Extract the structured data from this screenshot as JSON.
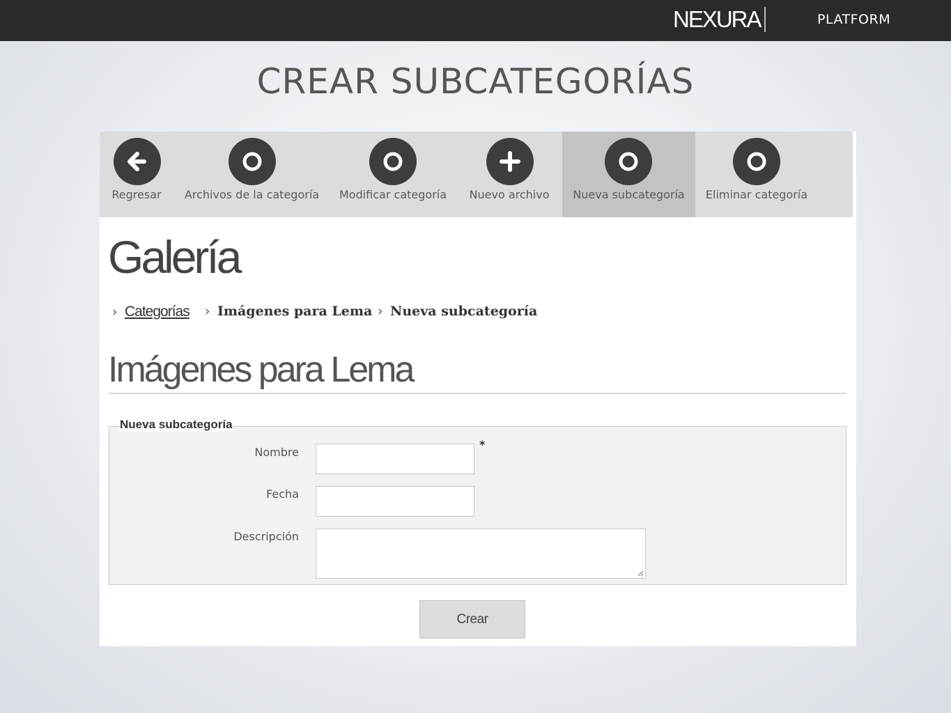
{
  "header": {
    "logo_text": "NEXURA",
    "product": "PLATFORM"
  },
  "slide": {
    "title": "CREAR SUBCATEGORÍAS"
  },
  "toolbar": {
    "items": [
      {
        "label": "Regresar",
        "icon": "arrow-left-icon"
      },
      {
        "label": "Archivos de la categoría",
        "icon": "circle-icon"
      },
      {
        "label": "Modificar categoría",
        "icon": "circle-icon"
      },
      {
        "label": "Nuevo archivo",
        "icon": "plus-icon"
      },
      {
        "label": "Nueva subcategoría",
        "icon": "circle-icon",
        "active": true
      },
      {
        "label": "Eliminar categoría",
        "icon": "circle-icon"
      }
    ]
  },
  "page": {
    "title": "Galería",
    "breadcrumb": [
      "Categorías",
      "Imágenes para Lema",
      "Nueva subcategoría"
    ],
    "section_title": "Imágenes para Lema"
  },
  "form": {
    "legend": "Nueva subcategoría",
    "fields": [
      {
        "label": "Nombre",
        "value": "",
        "required_mark": "*"
      },
      {
        "label": "Fecha",
        "value": ""
      },
      {
        "label": "Descripción",
        "value": ""
      }
    ],
    "submit_label": "Crear"
  },
  "colors": {
    "topbar": "#2a2a2a",
    "toolbar": "#dcdcdc",
    "toolbar_active": "#c3c3c3",
    "icon_circle": "#3d3d3d"
  }
}
